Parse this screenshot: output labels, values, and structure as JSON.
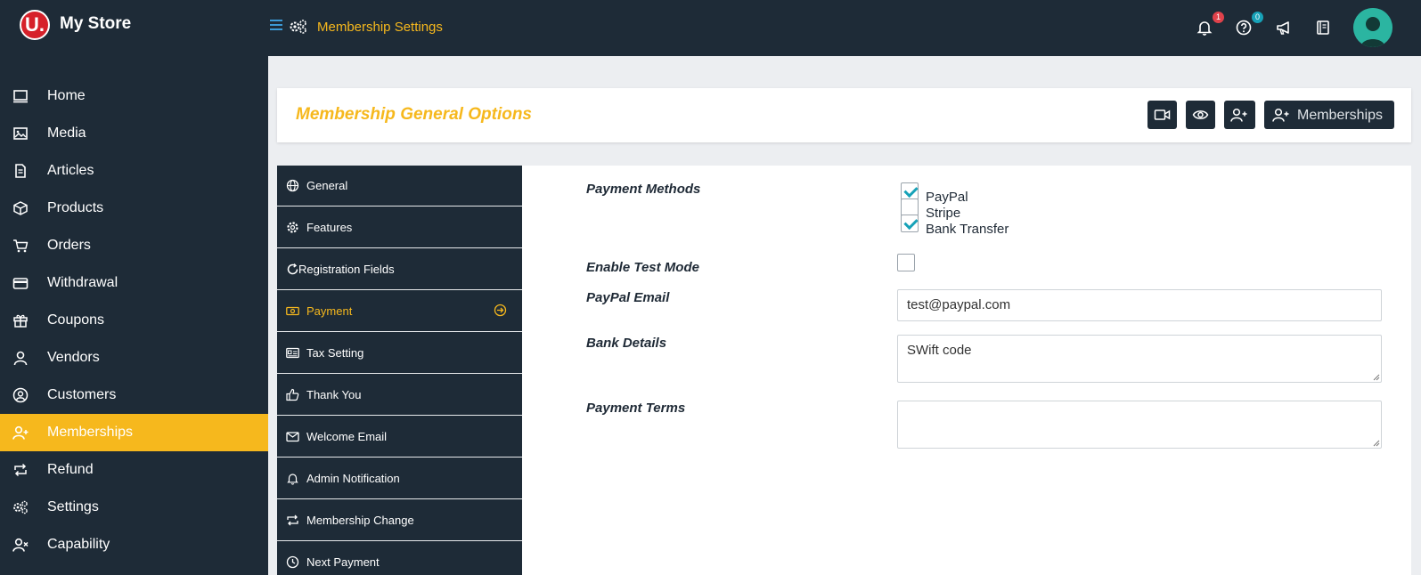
{
  "topbar": {
    "logo": "U.",
    "store_name": "My Store",
    "page_title": "Membership Settings",
    "notification_count": "1",
    "help_count": "0",
    "accent": "#f6b81d"
  },
  "sidebar": {
    "items": [
      {
        "label": "Home",
        "icon": "monitor-icon"
      },
      {
        "label": "Media",
        "icon": "image-icon"
      },
      {
        "label": "Articles",
        "icon": "document-icon"
      },
      {
        "label": "Products",
        "icon": "cube-icon"
      },
      {
        "label": "Orders",
        "icon": "cart-icon"
      },
      {
        "label": "Withdrawal",
        "icon": "credit-card-icon"
      },
      {
        "label": "Coupons",
        "icon": "gift-icon"
      },
      {
        "label": "Vendors",
        "icon": "user-icon"
      },
      {
        "label": "Customers",
        "icon": "user-circle-icon"
      },
      {
        "label": "Memberships",
        "icon": "user-plus-icon",
        "active": true
      },
      {
        "label": "Refund",
        "icon": "refund-icon"
      },
      {
        "label": "Settings",
        "icon": "gears-icon"
      },
      {
        "label": "Capability",
        "icon": "user-x-icon"
      }
    ]
  },
  "header": {
    "title": "Membership General Options",
    "memberships_button": "Memberships"
  },
  "tabs": [
    {
      "label": "General",
      "icon": "globe-icon"
    },
    {
      "label": "Features",
      "icon": "gear-icon"
    },
    {
      "label": "Registration Fields",
      "icon": "refresh-icon"
    },
    {
      "label": "Payment",
      "icon": "money-icon",
      "active": true
    },
    {
      "label": "Tax Setting",
      "icon": "id-card-icon"
    },
    {
      "label": "Thank You",
      "icon": "thumbs-up-icon"
    },
    {
      "label": "Welcome Email",
      "icon": "envelope-icon"
    },
    {
      "label": "Admin Notification",
      "icon": "bell-icon"
    },
    {
      "label": "Membership Change",
      "icon": "exchange-icon"
    },
    {
      "label": "Next Payment",
      "icon": "clock-icon"
    }
  ],
  "form": {
    "payment_methods_label": "Payment Methods",
    "methods": [
      {
        "label": "PayPal",
        "checked": true
      },
      {
        "label": "Stripe",
        "checked": false
      },
      {
        "label": "Bank Transfer",
        "checked": true
      }
    ],
    "test_mode_label": "Enable Test Mode",
    "test_mode_checked": false,
    "paypal_email_label": "PayPal Email",
    "paypal_email_value": "test@paypal.com",
    "bank_details_label": "Bank Details",
    "bank_details_value": "SWift code",
    "payment_terms_label": "Payment Terms",
    "payment_terms_value": ""
  }
}
